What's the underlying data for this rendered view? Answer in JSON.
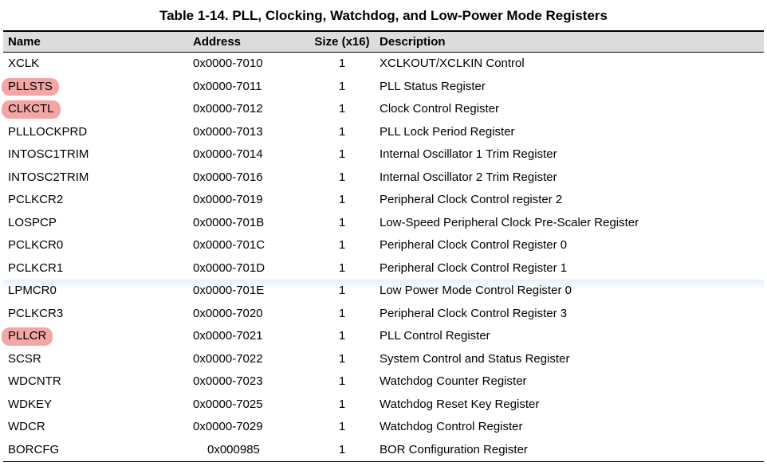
{
  "title": "Table 1-14. PLL, Clocking, Watchdog, and Low-Power Mode Registers",
  "headers": {
    "name": "Name",
    "address": "Address",
    "size": "Size (x16)",
    "description": "Description"
  },
  "chart_data": {
    "type": "table",
    "title": "Table 1-14. PLL, Clocking, Watchdog, and Low-Power Mode Registers",
    "columns": [
      "Name",
      "Address",
      "Size (x16)",
      "Description"
    ],
    "rows": [
      {
        "name": "XCLK",
        "address": "0x0000-7010",
        "size": "1",
        "description": "XCLKOUT/XCLKIN Control",
        "highlight": false,
        "row_highlight": false,
        "addr_indent": false
      },
      {
        "name": "PLLSTS",
        "address": "0x0000-7011",
        "size": "1",
        "description": "PLL Status Register",
        "highlight": true,
        "row_highlight": false,
        "addr_indent": false
      },
      {
        "name": "CLKCTL",
        "address": "0x0000-7012",
        "size": "1",
        "description": "Clock Control Register",
        "highlight": true,
        "row_highlight": false,
        "addr_indent": false
      },
      {
        "name": "PLLLOCKPRD",
        "address": "0x0000-7013",
        "size": "1",
        "description": "PLL Lock Period Register",
        "highlight": false,
        "row_highlight": false,
        "addr_indent": false
      },
      {
        "name": "INTOSC1TRIM",
        "address": "0x0000-7014",
        "size": "1",
        "description": "Internal Oscillator 1 Trim Register",
        "highlight": false,
        "row_highlight": false,
        "addr_indent": false
      },
      {
        "name": "INTOSC2TRIM",
        "address": "0x0000-7016",
        "size": "1",
        "description": "Internal Oscillator 2 Trim Register",
        "highlight": false,
        "row_highlight": false,
        "addr_indent": false
      },
      {
        "name": "PCLKCR2",
        "address": "0x0000-7019",
        "size": "1",
        "description": "Peripheral Clock Control register 2",
        "highlight": false,
        "row_highlight": false,
        "addr_indent": false
      },
      {
        "name": "LOSPCP",
        "address": "0x0000-701B",
        "size": "1",
        "description": "Low-Speed Peripheral Clock Pre-Scaler Register",
        "highlight": false,
        "row_highlight": false,
        "addr_indent": false
      },
      {
        "name": "PCLKCR0",
        "address": "0x0000-701C",
        "size": "1",
        "description": "Peripheral Clock Control Register 0",
        "highlight": false,
        "row_highlight": false,
        "addr_indent": false
      },
      {
        "name": "PCLKCR1",
        "address": "0x0000-701D",
        "size": "1",
        "description": "Peripheral Clock Control Register 1",
        "highlight": false,
        "row_highlight": false,
        "addr_indent": false
      },
      {
        "name": "LPMCR0",
        "address": "0x0000-701E",
        "size": "1",
        "description": "Low Power Mode Control Register 0",
        "highlight": false,
        "row_highlight": true,
        "addr_indent": false
      },
      {
        "name": "PCLKCR3",
        "address": "0x0000-7020",
        "size": "1",
        "description": "Peripheral Clock Control Register 3",
        "highlight": false,
        "row_highlight": false,
        "addr_indent": false
      },
      {
        "name": "PLLCR",
        "address": "0x0000-7021",
        "size": "1",
        "description": "PLL Control Register",
        "highlight": true,
        "row_highlight": false,
        "addr_indent": false
      },
      {
        "name": "SCSR",
        "address": "0x0000-7022",
        "size": "1",
        "description": "System Control and Status Register",
        "highlight": false,
        "row_highlight": false,
        "addr_indent": false
      },
      {
        "name": "WDCNTR",
        "address": "0x0000-7023",
        "size": "1",
        "description": "Watchdog Counter Register",
        "highlight": false,
        "row_highlight": false,
        "addr_indent": false
      },
      {
        "name": "WDKEY",
        "address": "0x0000-7025",
        "size": "1",
        "description": "Watchdog Reset Key Register",
        "highlight": false,
        "row_highlight": false,
        "addr_indent": false
      },
      {
        "name": "WDCR",
        "address": "0x0000-7029",
        "size": "1",
        "description": "Watchdog Control Register",
        "highlight": false,
        "row_highlight": false,
        "addr_indent": false
      },
      {
        "name": "BORCFG",
        "address": "0x000985",
        "size": "1",
        "description": "BOR Configuration Register",
        "highlight": false,
        "row_highlight": false,
        "addr_indent": true
      }
    ]
  }
}
